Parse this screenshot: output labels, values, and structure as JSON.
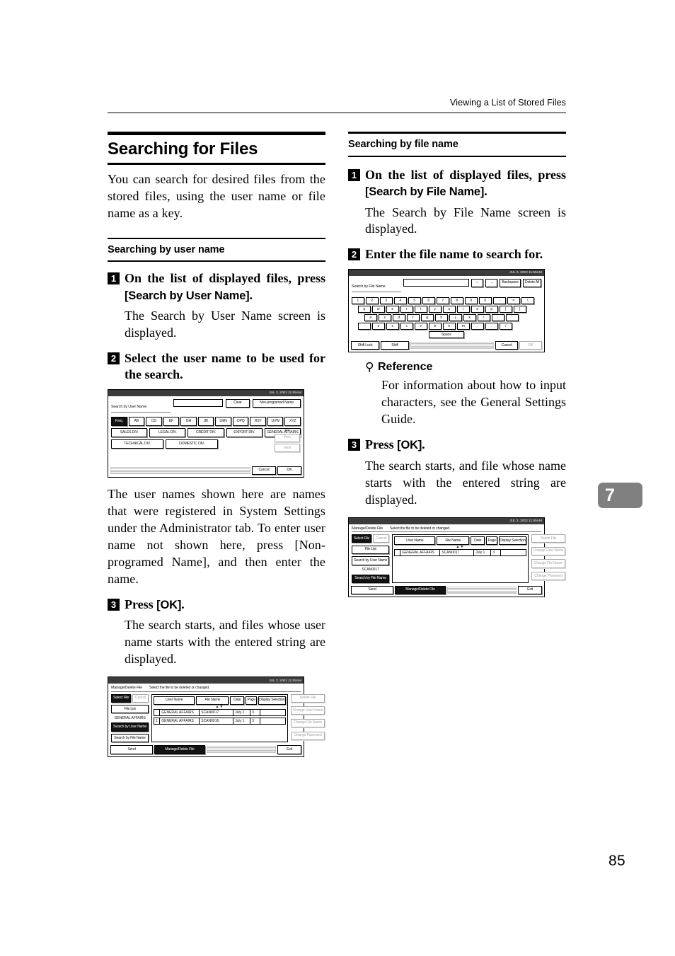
{
  "header": {
    "running_head": "Viewing a List of Stored Files"
  },
  "folio": {
    "page_number": "85",
    "chapter_tab": "7"
  },
  "left_column": {
    "title": "Searching for Files",
    "intro": "You can search for desired files from the stored files, using the user name or file name as a key.",
    "subhead": "Searching by user name",
    "step1": {
      "num": "1",
      "text_before": "On the list of displayed files, press ",
      "ui": "[Search by User Name]",
      "text_after": ".",
      "body": "The Search by User Name screen is displayed."
    },
    "step2": {
      "num": "2",
      "text": "Select the user name to be used for the search.",
      "body_a": "The user names shown here are names that were registered in System Settings under the Administrator tab. To enter user name not shown here, press ",
      "body_ui": "[Non-programed Name]",
      "body_b": ", and then enter the name."
    },
    "step3": {
      "num": "3",
      "text_before": "Press ",
      "ui": "[OK]",
      "text_after": ".",
      "body": "The search starts, and files whose user name starts with the entered string are displayed."
    }
  },
  "right_column": {
    "subhead": "Searching by file name",
    "step1": {
      "num": "1",
      "text_before": "On the list of displayed files, press ",
      "ui": "[Search by File Name]",
      "text_after": ".",
      "body": "The Search by File Name screen is displayed."
    },
    "step2": {
      "num": "2",
      "text": "Enter the file name to search for."
    },
    "reference": {
      "icon": "magnifier-icon",
      "label": "Reference",
      "body": "For information about how to input characters, see the General Settings Guide."
    },
    "step3": {
      "num": "3",
      "text_before": "Press ",
      "ui": "[OK]",
      "text_after": ".",
      "body": "The search starts, and file whose name starts with the entered string are displayed."
    }
  },
  "screens": {
    "search_by_user_name": {
      "clock": "JUL  3, 2002 11:55AM",
      "title": "Search by User Name",
      "input_value": "",
      "clear_label": "Clear",
      "non_programmed_label": "Non-programed Name",
      "tabs": [
        "Freq.",
        "AB",
        "CD",
        "EF",
        "GH",
        "IJK",
        "LMN",
        "OPQ",
        "RST",
        "UVW",
        "XYZ"
      ],
      "selected_tab": "Freq.",
      "names_row1": [
        "SALES DIV.",
        "LEGAL DIV.",
        "CREDIT DIV.",
        "EXPORT DIV.",
        "GENERAL AFFAIRS"
      ],
      "names_row2": [
        "TECHNICAL DIV.",
        "DOMESTIC DIV."
      ],
      "page_indicator": "1/1",
      "prev_label": "Prev.",
      "next_label": "Next",
      "cancel_label": "Cancel",
      "ok_label": "OK"
    },
    "search_by_file_name": {
      "clock": "JUL  3, 2002 11:55AM",
      "title": "Search by File Name",
      "input_value": "",
      "arrow_left": "←",
      "arrow_right": "→",
      "backspace_label": "Backspace",
      "delete_all_label": "Delete All",
      "key_row1": [
        "1",
        "2",
        "3",
        "4",
        "5",
        "6",
        "7",
        "8",
        "9",
        "0",
        "-",
        "=",
        "\\"
      ],
      "key_row2": [
        "q",
        "w",
        "e",
        "r",
        "t",
        "y",
        "u",
        "i",
        "o",
        "p",
        "[",
        "]"
      ],
      "key_row3": [
        "a",
        "s",
        "d",
        "f",
        "g",
        "h",
        "j",
        "k",
        "l",
        ";",
        "'"
      ],
      "key_row4": [
        "`",
        "z",
        "x",
        "c",
        "v",
        "b",
        "n",
        "m",
        ",",
        ".",
        "/"
      ],
      "space_label": "Space",
      "shift_lock_label": "Shift Lock",
      "shift_label": "Shift",
      "cancel_label": "Cancel",
      "ok_label": "OK"
    },
    "manage_delete_user_result": {
      "clock": "JUL  3, 2002 11:55AM",
      "title": "Manage/Delete File",
      "hint": "Select the file to be deleted or changed.",
      "select_file_label": "Select File",
      "cancel_label": "Cancel",
      "file_list_label": "File List",
      "search_term": "GENERAL AFFAIRS",
      "search_by_user_label": "Search by User Name",
      "search_by_file_label": "Search by File Name",
      "columns": [
        "User Name",
        "File Name",
        "Date",
        "Page",
        "Display Selection"
      ],
      "rows": [
        {
          "mark": "",
          "user_name": "GENERAL AFFAIRS",
          "file_name": "SCAN0017",
          "date": "July  1",
          "page": "3"
        },
        {
          "mark": "1",
          "user_name": "GENERAL AFFAIRS",
          "file_name": "SCAN0016",
          "date": "July  1",
          "page": "3"
        }
      ],
      "actions": [
        "Delete File",
        "Change User Name",
        "Change File Name",
        "Change Password"
      ],
      "send_label": "Send",
      "tab_label": "Manage/Delete File",
      "exit_label": "Exit"
    },
    "manage_delete_file_result": {
      "clock": "JUL  3, 2002 11:55AM",
      "title": "Manage/Delete File",
      "hint": "Select the file to be deleted or changed.",
      "select_file_label": "Select File",
      "cancel_label": "Cancel",
      "file_list_label": "File List",
      "search_term": "SCAN0017",
      "search_by_user_label": "Search by User Name",
      "search_by_file_label": "Search by File Name",
      "columns": [
        "User Name",
        "File Name",
        "Date",
        "Page",
        "Display Selection"
      ],
      "rows": [
        {
          "mark": "",
          "user_name": "GENERAL AFFAIRS",
          "file_name": "SCAN0017",
          "date": "July  1",
          "page": "3"
        }
      ],
      "actions": [
        "Delete File",
        "Change User Name",
        "Change File Name",
        "Change Password"
      ],
      "send_label": "Send",
      "tab_label": "Manage/Delete File",
      "exit_label": "Exit"
    }
  }
}
